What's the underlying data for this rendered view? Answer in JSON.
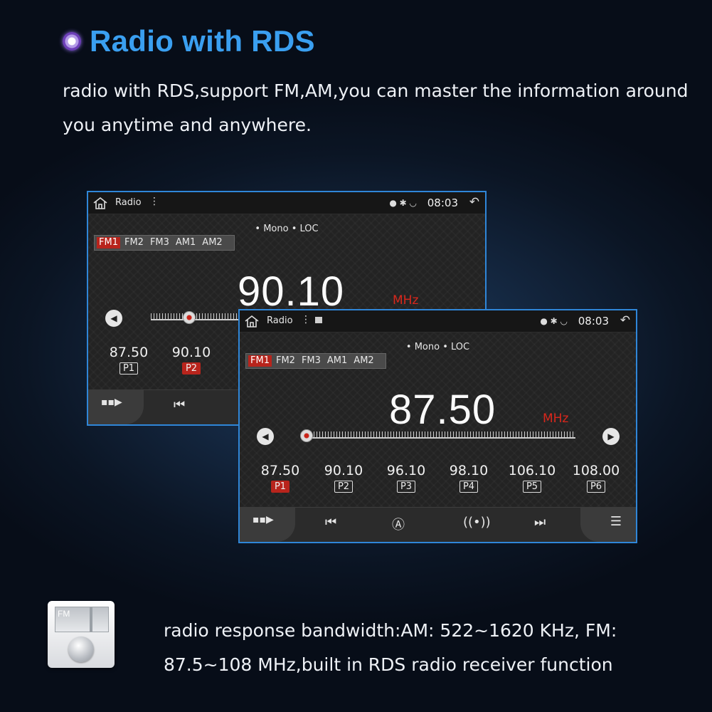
{
  "heading": {
    "title": "Radio with RDS"
  },
  "intro": "radio with RDS,support FM,AM,you can master the information around you anytime and anywhere.",
  "outro": "radio response bandwidth:AM: 522~1620 KHz, FM: 87.5~108 MHz,built in RDS radio receiver function",
  "app_icon": {
    "label": "FM"
  },
  "screen_back": {
    "app_title": "Radio",
    "time": "08:03",
    "mono": "• Mono   • LOC",
    "bands": [
      "FM1",
      "FM2",
      "FM3",
      "AM1",
      "AM2"
    ],
    "selected_band": "FM1",
    "frequency": "90.10",
    "unit": "MHz",
    "presets": [
      {
        "freq": "87.50",
        "label": "P1"
      },
      {
        "freq": "90.10",
        "label": "P2",
        "selected": true
      }
    ]
  },
  "screen_front": {
    "app_title": "Radio",
    "time": "08:03",
    "mono": "• Mono   • LOC",
    "bands": [
      "FM1",
      "FM2",
      "FM3",
      "AM1",
      "AM2"
    ],
    "selected_band": "FM1",
    "frequency": "87.50",
    "unit": "MHz",
    "presets": [
      {
        "freq": "87.50",
        "label": "P1",
        "selected": true
      },
      {
        "freq": "90.10",
        "label": "P2"
      },
      {
        "freq": "96.10",
        "label": "P3"
      },
      {
        "freq": "98.10",
        "label": "P4"
      },
      {
        "freq": "106.10",
        "label": "P5"
      },
      {
        "freq": "108.00",
        "label": "P6"
      }
    ]
  },
  "colors": {
    "title": "#3a9ff0",
    "accent_red": "#b8241c",
    "unit_red": "#d9271c",
    "border": "#2f86d8"
  }
}
